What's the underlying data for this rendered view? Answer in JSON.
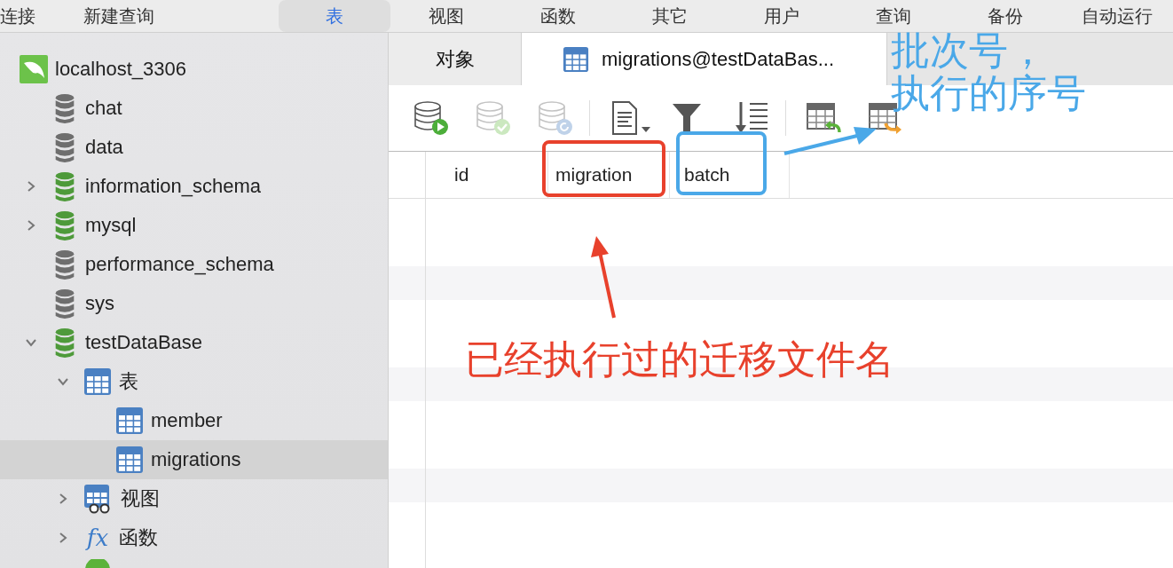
{
  "toolbar": [
    {
      "label": "连接",
      "selected": false
    },
    {
      "label": "新建查询",
      "selected": false
    },
    {
      "label": "表",
      "selected": true
    },
    {
      "label": "视图",
      "selected": false
    },
    {
      "label": "函数",
      "selected": false
    },
    {
      "label": "其它",
      "selected": false
    },
    {
      "label": "用户",
      "selected": false
    },
    {
      "label": "查询",
      "selected": false
    },
    {
      "label": "备份",
      "selected": false
    },
    {
      "label": "自动运行",
      "selected": false
    }
  ],
  "tree": [
    {
      "name": "localhost_3306",
      "kind": "server",
      "selected": false,
      "children": [
        {
          "name": "chat",
          "kind": "db-grey",
          "selected": false
        },
        {
          "name": "data",
          "kind": "db-grey",
          "selected": false
        },
        {
          "name": "information_schema",
          "kind": "db-green",
          "expanded": false,
          "selected": false
        },
        {
          "name": "mysql",
          "kind": "db-green",
          "expanded": false,
          "selected": false
        },
        {
          "name": "performance_schema",
          "kind": "db-grey",
          "selected": false
        },
        {
          "name": "sys",
          "kind": "db-grey",
          "selected": false
        },
        {
          "name": "testDataBase",
          "kind": "db-green",
          "expanded": true,
          "selected": false,
          "children": [
            {
              "name": "表",
              "kind": "table",
              "expanded": true,
              "selected": false,
              "children": [
                {
                  "name": "member",
                  "kind": "table",
                  "selected": false
                },
                {
                  "name": "migrations",
                  "kind": "table",
                  "selected": true
                }
              ]
            },
            {
              "name": "视图",
              "kind": "view",
              "expanded": false,
              "selected": false
            },
            {
              "name": "函数",
              "kind": "function",
              "icon_text": "fx",
              "expanded": false,
              "selected": false
            },
            {
              "kind": "green-circle",
              "selected": false
            }
          ]
        }
      ]
    }
  ],
  "tabs": [
    {
      "label": "对象",
      "kind": "plain",
      "selected": false
    },
    {
      "label": "migrations@testDataBas...",
      "kind": "table",
      "selected": true
    }
  ],
  "actions": [
    {
      "kind": "db-run",
      "disabled": false
    },
    {
      "kind": "db-check",
      "disabled": true
    },
    {
      "kind": "db-undo",
      "disabled": true
    },
    {
      "kind": "document",
      "disabled": false
    },
    {
      "kind": "filter",
      "disabled": false
    },
    {
      "kind": "sort",
      "disabled": false
    },
    {
      "kind": "table-import",
      "disabled": false
    },
    {
      "kind": "table-export",
      "disabled": false
    }
  ],
  "table": {
    "columns": [
      "id",
      "migration",
      "batch"
    ]
  },
  "annotations": [
    {
      "kind": "box-arrow-below",
      "color": "#e8412c",
      "lines": [
        "已经执行过的迁移文件名"
      ]
    },
    {
      "kind": "box-arrow-right",
      "color": "#4aa8e8",
      "lines": [
        "批次号，",
        "执行的序号"
      ]
    }
  ]
}
